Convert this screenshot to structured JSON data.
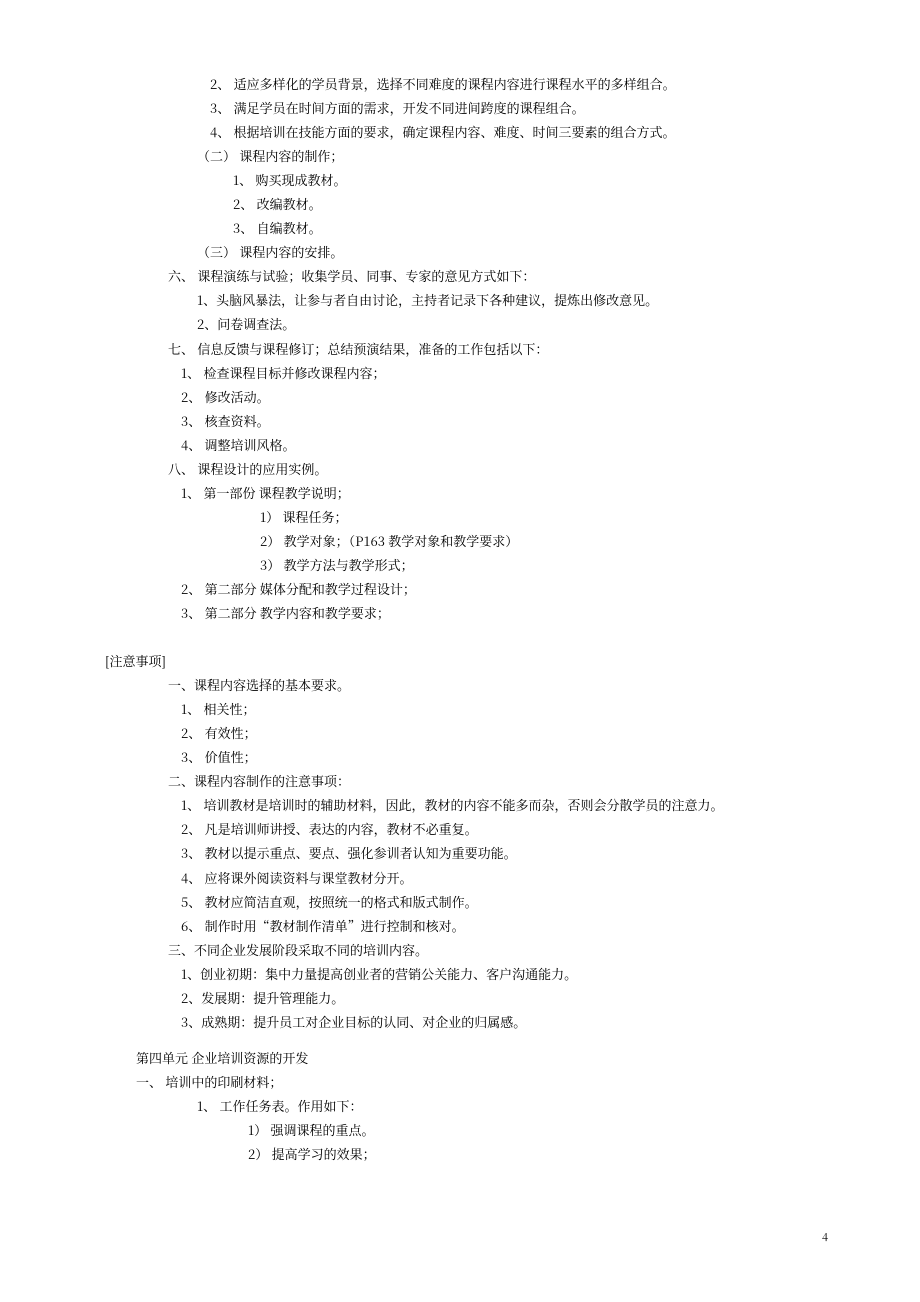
{
  "lines": [
    {
      "cls": "indent1",
      "bind": "l01",
      "text": "2、 适应多样化的学员背景，选择不同难度的课程内容进行课程水平的多样组合。"
    },
    {
      "cls": "indent1",
      "bind": "l02",
      "text": "3、 满足学员在时间方面的需求，开发不同进间跨度的课程组合。"
    },
    {
      "cls": "indent1",
      "bind": "l03",
      "text": "4、 根据培训在技能方面的要求，确定课程内容、难度、时间三要素的组合方式。"
    },
    {
      "cls": "indent1b",
      "bind": "l04",
      "text": "（二） 课程内容的制作；"
    },
    {
      "cls": "indent2",
      "bind": "l05",
      "text": "1、 购买现成教材。"
    },
    {
      "cls": "indent2",
      "bind": "l06",
      "text": "2、 改编教材。"
    },
    {
      "cls": "indent2",
      "bind": "l07",
      "text": "3、 自编教材。"
    },
    {
      "cls": "indent1b",
      "bind": "l08",
      "text": "（三） 课程内容的安排。"
    },
    {
      "cls": "indent0",
      "bind": "l09",
      "text": "六、 课程演练与试验；收集学员、同事、专家的意见方式如下："
    },
    {
      "cls": "indent1b",
      "bind": "l10",
      "text": "1、头脑风暴法，让参与者自由讨论，主持者记录下各种建议，提炼出修改意见。"
    },
    {
      "cls": "indent1b",
      "bind": "l11",
      "text": "2、问卷调查法。"
    },
    {
      "cls": "indent0",
      "bind": "l12",
      "text": "七、 信息反馈与课程修订；总结预演结果，准备的工作包括以下："
    },
    {
      "cls": "indent0b",
      "bind": "l13",
      "text": "1、 检查课程目标并修改课程内容；"
    },
    {
      "cls": "indent0b",
      "bind": "l14",
      "text": "2、 修改活动。"
    },
    {
      "cls": "indent0b",
      "bind": "l15",
      "text": "3、 核查资料。"
    },
    {
      "cls": "indent0b",
      "bind": "l16",
      "text": "4、 调整培训风格。"
    },
    {
      "cls": "indent0",
      "bind": "l17",
      "text": "八、 课程设计的应用实例。"
    },
    {
      "cls": "indent0b",
      "bind": "l18",
      "text": "1、 第一部份 课程教学说明；"
    },
    {
      "cls": "indent3",
      "bind": "l19",
      "text": "1） 课程任务；"
    },
    {
      "cls": "indent3",
      "bind": "l20",
      "text": "2） 教学对象；（P163 教学对象和教学要求）"
    },
    {
      "cls": "indent3",
      "bind": "l21",
      "text": "3） 教学方法与教学形式；"
    },
    {
      "cls": "indent0b",
      "bind": "l22",
      "text": "2、 第二部分 媒体分配和教学过程设计；"
    },
    {
      "cls": "indent0b",
      "bind": "l23",
      "text": "3、 第二部分 教学内容和教学要求；"
    },
    {
      "cls": "spacer",
      "bind": "",
      "text": ""
    },
    {
      "cls": "indentS",
      "bind": "l24",
      "text": "[注意事项]"
    },
    {
      "cls": "indent0",
      "bind": "l25",
      "text": "一、课程内容选择的基本要求。"
    },
    {
      "cls": "indent0b",
      "bind": "l26",
      "text": "1、 相关性；"
    },
    {
      "cls": "indent0b",
      "bind": "l27",
      "text": "2、 有效性；"
    },
    {
      "cls": "indent0b",
      "bind": "l28",
      "text": "3、 价值性；"
    },
    {
      "cls": "indent0",
      "bind": "l29",
      "text": "二、课程内容制作的注意事项："
    },
    {
      "cls": "indent0b",
      "bind": "l30",
      "text": "1、 培训教材是培训时的辅助材料，因此，教材的内容不能多而杂，否则会分散学员的注意力。"
    },
    {
      "cls": "indent0b",
      "bind": "l31",
      "text": "2、 凡是培训师讲授、表达的内容，教材不必重复。"
    },
    {
      "cls": "indent0b",
      "bind": "l32",
      "text": "3、 教材以提示重点、要点、强化参训者认知为重要功能。"
    },
    {
      "cls": "indent0b",
      "bind": "l33",
      "text": "4、 应将课外阅读资料与课堂教材分开。"
    },
    {
      "cls": "indent0b",
      "bind": "l34",
      "text": "5、 教材应简洁直观，按照统一的格式和版式制作。"
    },
    {
      "cls": "indent0b",
      "bind": "l35",
      "text": "6、 制作时用“教材制作清单”进行控制和核对。"
    },
    {
      "cls": "indent0",
      "bind": "l36",
      "text": "三、不同企业发展阶段采取不同的培训内容。"
    },
    {
      "cls": "indent0b",
      "bind": "l37",
      "text": "1、创业初期：集中力量提高创业者的营销公关能力、客户沟通能力。"
    },
    {
      "cls": "indent0b",
      "bind": "l38",
      "text": "2、发展期：提升管理能力。"
    },
    {
      "cls": "indent0b",
      "bind": "l39",
      "text": "3、成熟期：提升员工对企业目标的认同、对企业的归属感。"
    },
    {
      "cls": "spacer-small",
      "bind": "",
      "text": ""
    },
    {
      "cls": "indentA",
      "bind": "l40",
      "text": "第四单元 企业培训资源的开发"
    },
    {
      "cls": "indentU",
      "bind": "l41",
      "text": "一、 培训中的印刷材料；"
    },
    {
      "cls": "indent1b",
      "bind": "l42",
      "text": "1、 工作任务表。作用如下："
    },
    {
      "cls": "indent2b",
      "bind": "l43",
      "text": "1） 强调课程的重点。"
    },
    {
      "cls": "indent2b",
      "bind": "l44",
      "text": "2） 提高学习的效果；"
    }
  ],
  "pagenum": "4",
  "content": {
    "l01": "2、 适应多样化的学员背景，选择不同难度的课程内容进行课程水平的多样组合。",
    "l02": "3、 满足学员在时间方面的需求，开发不同进间跨度的课程组合。",
    "l03": "4、 根据培训在技能方面的要求，确定课程内容、难度、时间三要素的组合方式。",
    "l04": "（二） 课程内容的制作；",
    "l05": "1、 购买现成教材。",
    "l06": "2、 改编教材。",
    "l07": "3、 自编教材。",
    "l08": "（三） 课程内容的安排。",
    "l09": "六、 课程演练与试验；收集学员、同事、专家的意见方式如下：",
    "l10": "1、头脑风暴法，让参与者自由讨论，主持者记录下各种建议，提炼出修改意见。",
    "l11": "2、问卷调查法。",
    "l12": "七、 信息反馈与课程修订；总结预演结果，准备的工作包括以下：",
    "l13": "1、 检查课程目标并修改课程内容；",
    "l14": "2、 修改活动。",
    "l15": "3、 核查资料。",
    "l16": "4、 调整培训风格。",
    "l17": "八、 课程设计的应用实例。",
    "l18": "1、 第一部份 课程教学说明；",
    "l19": "1） 课程任务；",
    "l20": "2） 教学对象；（P163 教学对象和教学要求）",
    "l21": "3） 教学方法与教学形式；",
    "l22": "2、 第二部分 媒体分配和教学过程设计；",
    "l23": "3、 第二部分 教学内容和教学要求；",
    "l24": "[注意事项]",
    "l25": "一、课程内容选择的基本要求。",
    "l26": "1、 相关性；",
    "l27": "2、 有效性；",
    "l28": "3、 价值性；",
    "l29": "二、课程内容制作的注意事项：",
    "l30": "1、 培训教材是培训时的辅助材料，因此，教材的内容不能多而杂，否则会分散学员的注意力。",
    "l31": "2、 凡是培训师讲授、表达的内容，教材不必重复。",
    "l32": "3、 教材以提示重点、要点、强化参训者认知为重要功能。",
    "l33": "4、 应将课外阅读资料与课堂教材分开。",
    "l34": "5、 教材应简洁直观，按照统一的格式和版式制作。",
    "l35": "6、 制作时用“教材制作清单”进行控制和核对。",
    "l36": "三、不同企业发展阶段采取不同的培训内容。",
    "l37": "1、创业初期：集中力量提高创业者的营销公关能力、客户沟通能力。",
    "l38": "2、发展期：提升管理能力。",
    "l39": "3、成熟期：提升员工对企业目标的认同、对企业的归属感。",
    "l40": "第四单元 企业培训资源的开发",
    "l41": "一、 培训中的印刷材料；",
    "l42": "1、 工作任务表。作用如下：",
    "l43": "1） 强调课程的重点。",
    "l44": "2） 提高学习的效果；"
  }
}
